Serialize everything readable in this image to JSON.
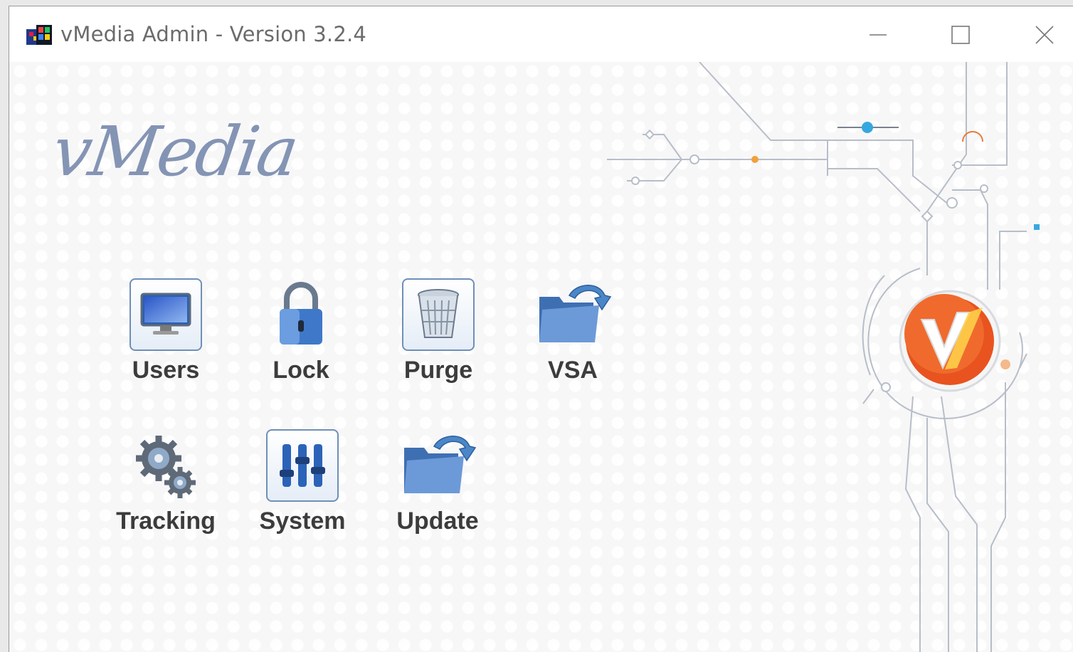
{
  "window": {
    "title": "vMedia Admin - Version 3.2.4"
  },
  "brand": {
    "logo_text": "vMedia"
  },
  "launchers": {
    "users": {
      "label": "Users",
      "icon": "monitor-icon"
    },
    "lock": {
      "label": "Lock",
      "icon": "padlock-icon"
    },
    "purge": {
      "label": "Purge",
      "icon": "trash-bin-icon"
    },
    "vsa": {
      "label": "VSA",
      "icon": "folder-arrow-icon"
    },
    "tracking": {
      "label": "Tracking",
      "icon": "gears-icon"
    },
    "system": {
      "label": "System",
      "icon": "sliders-icon"
    },
    "update": {
      "label": "Update",
      "icon": "folder-arrow-icon"
    }
  },
  "colors": {
    "accent_blue": "#3d6fb0",
    "logo_orange": "#e8531f",
    "circuit_gray": "#b7bec8"
  }
}
